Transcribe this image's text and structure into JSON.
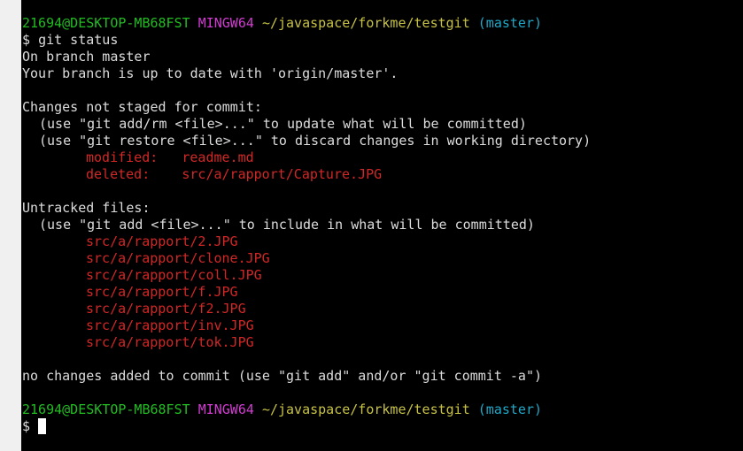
{
  "colors": {
    "background": "#000000",
    "text": "#dcdcdc",
    "user_host": "#22bc22",
    "system": "#d13cd1",
    "path": "#c7c244",
    "branch": "#1fa8c8",
    "status_red": "#d12727"
  },
  "prompt": {
    "user_host": "21694@DESKTOP-MB68FST",
    "system": "MINGW64",
    "path": "~/javaspace/forkme/testgit",
    "branch": "(master)",
    "symbol": "$"
  },
  "command": "git status",
  "output": {
    "branch_line": "On branch master",
    "uptodate_line": "Your branch is up to date with 'origin/master'.",
    "not_staged_header": "Changes not staged for commit:",
    "not_staged_hint1": "(use \"git add/rm <file>...\" to update what will be committed)",
    "not_staged_hint2": "(use \"git restore <file>...\" to discard changes in working directory)",
    "changes": [
      {
        "status": "modified:",
        "file": "readme.md"
      },
      {
        "status": "deleted:",
        "file": "src/a/rapport/Capture.JPG"
      }
    ],
    "untracked_header": "Untracked files:",
    "untracked_hint": "(use \"git add <file>...\" to include in what will be committed)",
    "untracked_files": [
      "src/a/rapport/2.JPG",
      "src/a/rapport/clone.JPG",
      "src/a/rapport/coll.JPG",
      "src/a/rapport/f.JPG",
      "src/a/rapport/f2.JPG",
      "src/a/rapport/inv.JPG",
      "src/a/rapport/tok.JPG"
    ],
    "summary": "no changes added to commit (use \"git add\" and/or \"git commit -a\")"
  }
}
